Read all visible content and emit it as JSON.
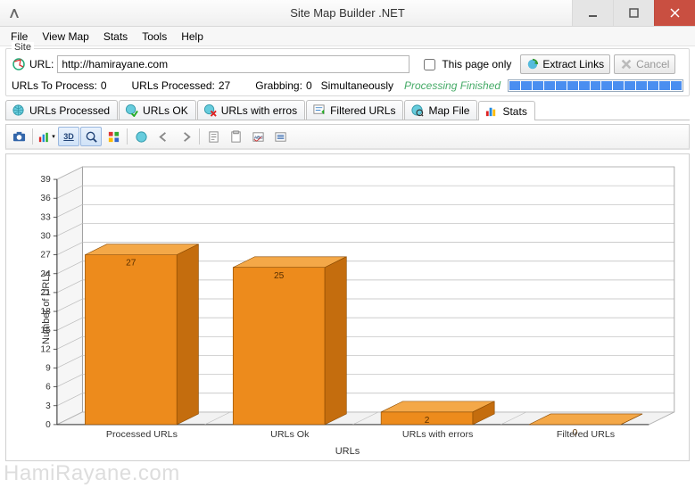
{
  "window": {
    "title": "Site Map Builder .NET"
  },
  "menu": {
    "items": [
      "File",
      "View Map",
      "Stats",
      "Tools",
      "Help"
    ]
  },
  "site_group": {
    "legend": "Site",
    "url_label": "URL:",
    "url_value": "http://hamirayane.com",
    "this_page_only_label": "This page only",
    "this_page_only_checked": false,
    "extract_button": "Extract Links",
    "cancel_button": "Cancel"
  },
  "status": {
    "to_process_label": "URLs To Process:",
    "to_process_value": "0",
    "processed_label": "URLs Processed:",
    "processed_value": "27",
    "grabbing_label": "Grabbing:",
    "grabbing_value": "0",
    "simultaneously_label": "Simultaneously",
    "finished_text": "Processing Finished"
  },
  "tabs": {
    "items": [
      {
        "label": "URLs Processed",
        "icon": "globe-icon"
      },
      {
        "label": "URLs OK",
        "icon": "globe-check-icon"
      },
      {
        "label": "URLs with erros",
        "icon": "globe-x-icon"
      },
      {
        "label": "Filtered URLs",
        "icon": "filter-icon"
      },
      {
        "label": "Map File",
        "icon": "map-icon"
      },
      {
        "label": "Stats",
        "icon": "bar-chart-icon"
      }
    ],
    "selected": 5
  },
  "chart_toolbar": {
    "buttons": [
      {
        "name": "camera-icon"
      },
      {
        "name": "chart-type-icon"
      },
      {
        "name": "3d-icon",
        "text": "3D",
        "pressed": true
      },
      {
        "name": "zoom-icon",
        "pressed": true
      },
      {
        "name": "color-icon"
      },
      {
        "name": "globe-icon"
      },
      {
        "name": "arrow-left-icon"
      },
      {
        "name": "arrow-right-icon"
      },
      {
        "name": "page-icon"
      },
      {
        "name": "clipboard-icon"
      },
      {
        "name": "abc-icon"
      },
      {
        "name": "list-icon"
      }
    ]
  },
  "chart_data": {
    "type": "bar",
    "title": "",
    "xlabel": "URLs",
    "ylabel": "Number of URLs",
    "ylim": [
      0,
      39
    ],
    "y_ticks": [
      0,
      3,
      6,
      9,
      12,
      15,
      18,
      21,
      24,
      27,
      30,
      33,
      36,
      39
    ],
    "categories": [
      "Processed URLs",
      "URLs Ok",
      "URLs with errors",
      "Filtered URLs"
    ],
    "values": [
      27,
      25,
      2,
      0
    ],
    "bar_color": "#ED8B1C",
    "bar_color_top": "#F4A848",
    "bar_color_side": "#C46D0E"
  },
  "watermark": "HamiRayane.com"
}
